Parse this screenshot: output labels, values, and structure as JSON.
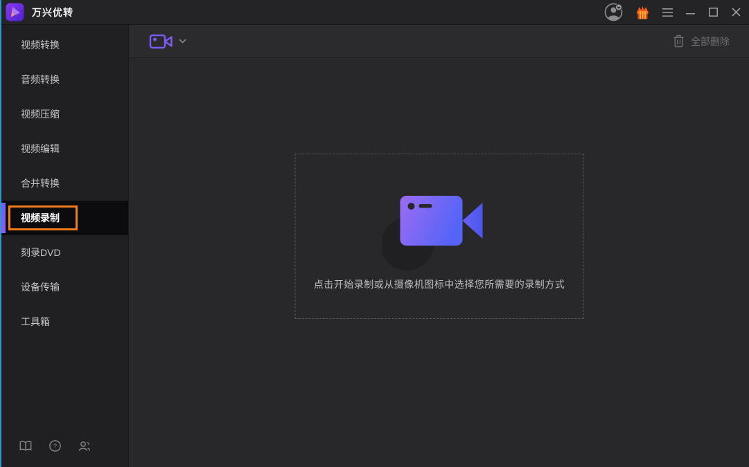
{
  "titlebar": {
    "app_title": "万兴优转",
    "icons": {
      "logo": "app-logo-play",
      "avatar": "user-account",
      "gift": "promotions-gift",
      "menu": "hamburger-menu",
      "minimize": "minimize",
      "maximize": "maximize",
      "close": "close"
    }
  },
  "sidebar": {
    "items": [
      {
        "label": "视频转换"
      },
      {
        "label": "音频转换"
      },
      {
        "label": "视频压缩"
      },
      {
        "label": "视频编辑"
      },
      {
        "label": "合并转换"
      },
      {
        "label": "视频录制",
        "active": true,
        "highlight_box": true
      },
      {
        "label": "刻录DVD"
      },
      {
        "label": "设备传输"
      },
      {
        "label": "工具箱"
      }
    ],
    "footer_icons": [
      "user-guide-book",
      "help-question",
      "contact-support"
    ]
  },
  "toolbar": {
    "record_source_icon": "video-camera",
    "chevron_icon": "chevron-down",
    "trash_icon": "trash",
    "delete_all_label": "全部删除"
  },
  "content": {
    "center_icon": "video-camera-gradient",
    "hint": "点击开始录制或从摄像机图标中选择您所需要的录制方式"
  },
  "colors": {
    "accent_purple": "#7c5cf5",
    "highlight_orange": "#ef7c1b",
    "selection_bar_purple": "#7a5ef3",
    "camera_gradient_start": "#9c6cf2",
    "camera_gradient_end": "#5564f7",
    "window_edge_blue": "#2d97d0",
    "gift_orange": "#ff5a14"
  }
}
